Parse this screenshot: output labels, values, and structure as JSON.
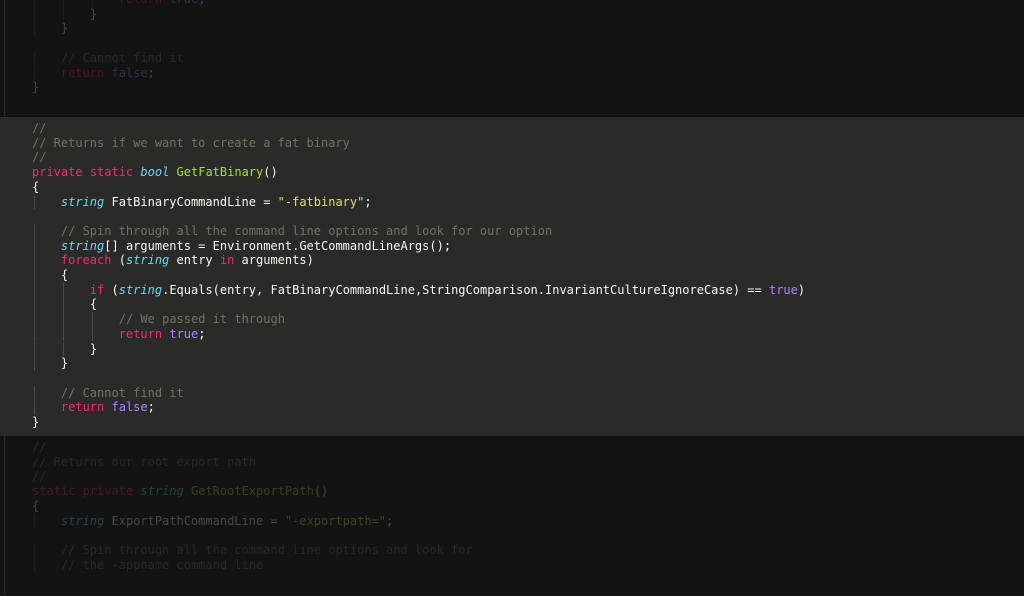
{
  "theme": {
    "background": "#101010",
    "highlight_background": "#2a2a28",
    "keyword": "#f92672",
    "type": "#66d9ef",
    "function": "#a6e22e",
    "string": "#e6db74",
    "constant": "#ae81ff",
    "comment": "#75715e",
    "text": "#f8f8f2"
  },
  "code": {
    "top_context": [
      {
        "indent": 6,
        "tokens": [
          {
            "t": "kw",
            "v": "return"
          },
          {
            "t": "plain",
            "v": " "
          },
          {
            "t": "const",
            "v": "true"
          },
          {
            "t": "plain",
            "v": ";"
          }
        ]
      },
      {
        "indent": 4,
        "tokens": [
          {
            "t": "plain",
            "v": "}"
          }
        ]
      },
      {
        "indent": 2,
        "tokens": [
          {
            "t": "plain",
            "v": "}"
          }
        ]
      },
      {
        "indent": 0,
        "tokens": []
      },
      {
        "indent": 2,
        "tokens": [
          {
            "t": "cm",
            "v": "// Cannot find it"
          }
        ]
      },
      {
        "indent": 2,
        "tokens": [
          {
            "t": "kw",
            "v": "return"
          },
          {
            "t": "plain",
            "v": " "
          },
          {
            "t": "const",
            "v": "false"
          },
          {
            "t": "plain",
            "v": ";"
          }
        ]
      },
      {
        "indent": 0,
        "tokens": [
          {
            "t": "plain",
            "v": "}"
          }
        ]
      }
    ],
    "focused": [
      {
        "indent": 0,
        "tokens": [
          {
            "t": "cm",
            "v": "//"
          }
        ]
      },
      {
        "indent": 0,
        "tokens": [
          {
            "t": "cm",
            "v": "// Returns if we want to create a fat binary"
          }
        ]
      },
      {
        "indent": 0,
        "tokens": [
          {
            "t": "cm",
            "v": "//"
          }
        ]
      },
      {
        "indent": 0,
        "tokens": [
          {
            "t": "kw",
            "v": "private"
          },
          {
            "t": "plain",
            "v": " "
          },
          {
            "t": "kw",
            "v": "static"
          },
          {
            "t": "plain",
            "v": " "
          },
          {
            "t": "type",
            "v": "bool"
          },
          {
            "t": "plain",
            "v": " "
          },
          {
            "t": "fn",
            "v": "GetFatBinary"
          },
          {
            "t": "plain",
            "v": "()"
          }
        ]
      },
      {
        "indent": 0,
        "tokens": [
          {
            "t": "plain",
            "v": "{"
          }
        ]
      },
      {
        "indent": 2,
        "tokens": [
          {
            "t": "type",
            "v": "string"
          },
          {
            "t": "plain",
            "v": " FatBinaryCommandLine = "
          },
          {
            "t": "str",
            "v": "\"-fatbinary\""
          },
          {
            "t": "plain",
            "v": ";"
          }
        ]
      },
      {
        "indent": 0,
        "tokens": []
      },
      {
        "indent": 2,
        "tokens": [
          {
            "t": "cm",
            "v": "// Spin through all the command line options and look for our option"
          }
        ]
      },
      {
        "indent": 2,
        "tokens": [
          {
            "t": "type",
            "v": "string"
          },
          {
            "t": "plain",
            "v": "[] arguments = Environment.GetCommandLineArgs();"
          }
        ]
      },
      {
        "indent": 2,
        "tokens": [
          {
            "t": "kw",
            "v": "foreach"
          },
          {
            "t": "plain",
            "v": " ("
          },
          {
            "t": "type",
            "v": "string"
          },
          {
            "t": "plain",
            "v": " entry "
          },
          {
            "t": "kw",
            "v": "in"
          },
          {
            "t": "plain",
            "v": " arguments)"
          }
        ]
      },
      {
        "indent": 2,
        "tokens": [
          {
            "t": "plain",
            "v": "{"
          }
        ]
      },
      {
        "indent": 4,
        "tokens": [
          {
            "t": "kw",
            "v": "if"
          },
          {
            "t": "plain",
            "v": " ("
          },
          {
            "t": "type",
            "v": "string"
          },
          {
            "t": "plain",
            "v": ".Equals(entry, FatBinaryCommandLine,StringComparison.InvariantCultureIgnoreCase) == "
          },
          {
            "t": "const",
            "v": "true"
          },
          {
            "t": "plain",
            "v": ")"
          }
        ]
      },
      {
        "indent": 4,
        "tokens": [
          {
            "t": "plain",
            "v": "{"
          }
        ]
      },
      {
        "indent": 6,
        "tokens": [
          {
            "t": "cm",
            "v": "// We passed it through"
          }
        ]
      },
      {
        "indent": 6,
        "tokens": [
          {
            "t": "kw",
            "v": "return"
          },
          {
            "t": "plain",
            "v": " "
          },
          {
            "t": "const",
            "v": "true"
          },
          {
            "t": "plain",
            "v": ";"
          }
        ]
      },
      {
        "indent": 4,
        "tokens": [
          {
            "t": "plain",
            "v": "}"
          }
        ]
      },
      {
        "indent": 2,
        "tokens": [
          {
            "t": "plain",
            "v": "}"
          }
        ]
      },
      {
        "indent": 0,
        "tokens": []
      },
      {
        "indent": 2,
        "tokens": [
          {
            "t": "cm",
            "v": "// Cannot find it"
          }
        ]
      },
      {
        "indent": 2,
        "tokens": [
          {
            "t": "kw",
            "v": "return"
          },
          {
            "t": "plain",
            "v": " "
          },
          {
            "t": "const",
            "v": "false"
          },
          {
            "t": "plain",
            "v": ";"
          }
        ]
      },
      {
        "indent": 0,
        "tokens": [
          {
            "t": "plain",
            "v": "}"
          }
        ]
      }
    ],
    "bottom_context": [
      {
        "indent": 0,
        "tokens": [
          {
            "t": "cm",
            "v": "//"
          }
        ]
      },
      {
        "indent": 0,
        "tokens": [
          {
            "t": "cm",
            "v": "// Returns our root export path"
          }
        ]
      },
      {
        "indent": 0,
        "tokens": [
          {
            "t": "cm",
            "v": "//"
          }
        ]
      },
      {
        "indent": 0,
        "tokens": [
          {
            "t": "kw",
            "v": "static"
          },
          {
            "t": "plain",
            "v": " "
          },
          {
            "t": "kw",
            "v": "private"
          },
          {
            "t": "plain",
            "v": " "
          },
          {
            "t": "type",
            "v": "string"
          },
          {
            "t": "plain",
            "v": " "
          },
          {
            "t": "fn",
            "v": "GetRootExportPath"
          },
          {
            "t": "plain",
            "v": "()"
          }
        ]
      },
      {
        "indent": 0,
        "tokens": [
          {
            "t": "plain",
            "v": "{"
          }
        ]
      },
      {
        "indent": 2,
        "tokens": [
          {
            "t": "type",
            "v": "string"
          },
          {
            "t": "plain",
            "v": " ExportPathCommandLine = "
          },
          {
            "t": "str",
            "v": "\"-exportpath=\""
          },
          {
            "t": "plain",
            "v": ";"
          }
        ]
      },
      {
        "indent": 0,
        "tokens": []
      },
      {
        "indent": 2,
        "tokens": [
          {
            "t": "cm",
            "v": "// Spin through all the command line options and look for"
          }
        ]
      },
      {
        "indent": 2,
        "tokens": [
          {
            "t": "cm",
            "v": "// the -appname command line"
          }
        ]
      }
    ]
  }
}
